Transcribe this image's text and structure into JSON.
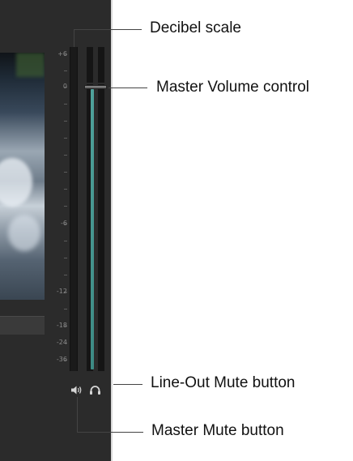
{
  "colors": {
    "panel_bg": "#2b2b2b",
    "meter_fill": "#4fa29b",
    "tick_text": "#8a8a8a",
    "callout_text": "#111111"
  },
  "scale": {
    "range_db": [
      -36,
      6
    ],
    "labels": [
      "+6",
      "0",
      "-6",
      "-12",
      "-18",
      "-24",
      "-36"
    ]
  },
  "volume": {
    "level_db": 0
  },
  "icons": {
    "master_mute": "speaker-icon",
    "lineout_mute": "headphones-icon"
  },
  "callouts": {
    "decibel_scale": "Decibel scale",
    "master_volume": "Master Volume control",
    "lineout_mute": "Line-Out Mute button",
    "master_mute": "Master Mute button"
  }
}
